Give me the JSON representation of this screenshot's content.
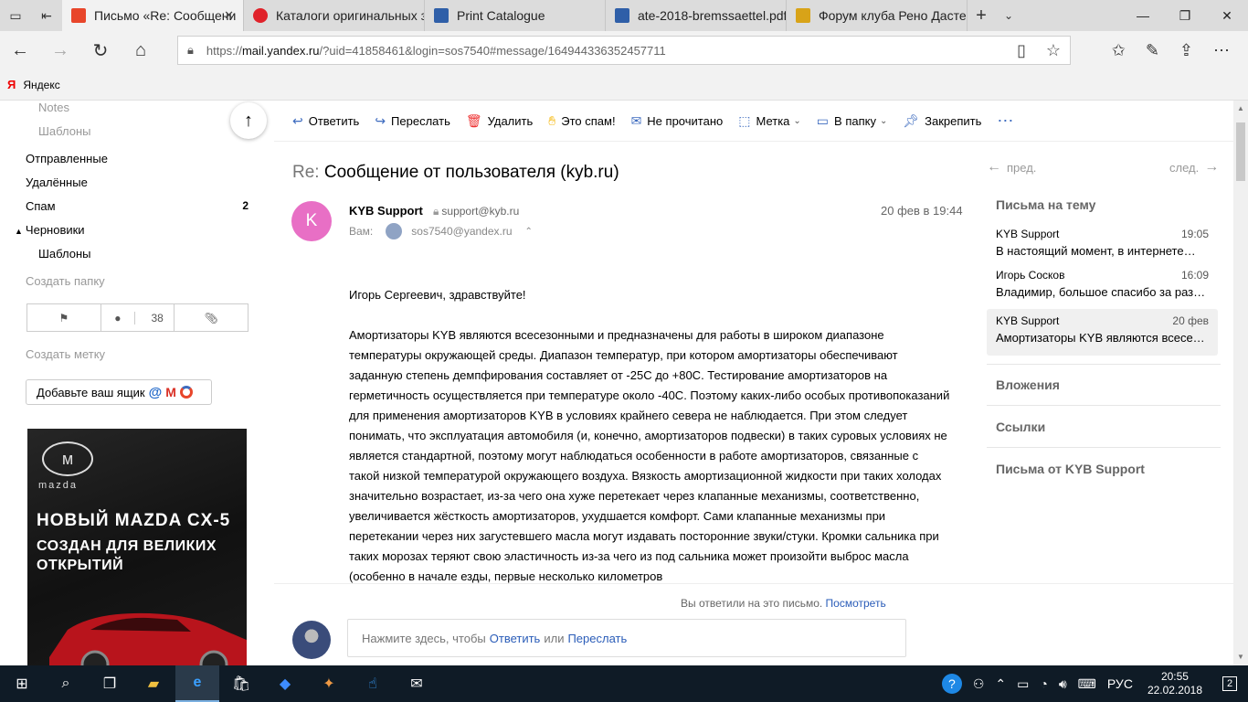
{
  "browser": {
    "tabs": [
      {
        "title": "Письмо «Re: Сообщени",
        "favicon_color": "#e8462b",
        "active": true
      },
      {
        "title": "Каталоги оригинальных за",
        "favicon_color": "#e0222a",
        "active": false
      },
      {
        "title": "Print Catalogue",
        "favicon_color": "#2f5fa8",
        "active": false
      },
      {
        "title": "ate-2018-bremssaettel.pdf",
        "favicon_color": "#2f5fa8",
        "active": false
      },
      {
        "title": "Форум клуба Рено Дастер",
        "favicon_color": "#d8a318",
        "active": false
      }
    ],
    "url_prefix": "https://",
    "url_host": "mail.yandex.ru",
    "url_rest": "/?uid=41858461&login=sos7540#message/164944336352457711",
    "favorites": [
      {
        "label": "Яндекс",
        "icon": "Я"
      }
    ]
  },
  "sidebar": {
    "notes": "Notes",
    "templates_top": "Шаблоны",
    "folders": [
      {
        "label": "Отправленные",
        "count": ""
      },
      {
        "label": "Удалённые",
        "count": ""
      },
      {
        "label": "Спам",
        "count": "2"
      },
      {
        "label": "Черновики",
        "count": ""
      }
    ],
    "templates": "Шаблоны",
    "create_folder": "Создать папку",
    "filter_unread_count": "38",
    "create_label": "Создать метку",
    "add_mailbox": "Добавьте ваш ящик"
  },
  "ad": {
    "brand": "mazda",
    "title": "НОВЫЙ MAZDA CX-5",
    "subtitle": "СОЗДАН ДЛЯ ВЕЛИКИХ ОТКРЫТИЙ"
  },
  "toolbar": {
    "reply": "Ответить",
    "forward": "Переслать",
    "delete": "Удалить",
    "spam": "Это спам!",
    "unread": "Не прочитано",
    "label": "Метка",
    "to_folder": "В папку",
    "pin": "Закрепить"
  },
  "message": {
    "subject_prefix": "Re:",
    "subject": "Сообщение от пользователя (kyb.ru)",
    "avatar_letter": "K",
    "from_name": "KYB Support",
    "from_email": "support@kyb.ru",
    "to_label": "Вам:",
    "to_email": "sos7540@yandex.ru",
    "date": "20 фев в 19:44",
    "greeting": "Игорь Сергеевич, здравствуйте!",
    "body": "Амортизаторы KYB являются всесезонными и предназначены для работы в широком диапазоне температуры окружающей среды. Диапазон температур, при котором амортизаторы обеспечивают заданную степень демпфирования составляет от -25С до +80С. Тестирование амортизаторов на герметичность осуществляется при температуре около -40С. Поэтому каких-либо особых противопоказаний для применения амортизаторов KYB в условиях крайнего севера не наблюдается. При этом следует понимать, что эксплуатация автомобиля (и, конечно, амортизаторов подвески) в таких суровых условиях не является стандартной, поэтому могут наблюдаться особенности в работе амортизаторов, связанные с такой низкой температурой окружающего воздуха. Вязкость амортизационной жидкости при таких холодах значительно возрастает, из-за чего она хуже перетекает через клапанные механизмы, соответственно, увеличивается жёсткость амортизаторов, ухудшается комфорт. Сами клапанные механизмы при перетекании через них загустевшего масла могут издавать посторонние звуки/стуки. Кромки сальника при таких морозах теряют свою эластичность  из-за чего из под сальника может произойти выброс масла (особенно в начале езды, первые несколько километров"
  },
  "reply": {
    "replied_text": "Вы ответили на это письмо.",
    "view_link": "Посмотреть",
    "prompt_before": "Нажмите здесь, чтобы",
    "reply_link": "Ответить",
    "or": "или",
    "forward_link": "Переслать"
  },
  "right_panel": {
    "prev": "пред.",
    "next": "след.",
    "thread_heading": "Письма на тему",
    "threads": [
      {
        "name": "KYB Support",
        "time": "19:05",
        "snippet": "В настоящий момент, в интернете…"
      },
      {
        "name": "Игорь Сосков",
        "time": "16:09",
        "snippet": "Владимир, большое спасибо за раз…"
      },
      {
        "name": "KYB Support",
        "time": "20 фев",
        "snippet": "Амортизаторы KYB являются всесе…"
      }
    ],
    "attachments": "Вложения",
    "links": "Ссылки",
    "from_sender": "Письма от KYB Support"
  },
  "taskbar": {
    "language": "РУС",
    "time": "20:55",
    "date": "22.02.2018",
    "notifications": "2"
  }
}
